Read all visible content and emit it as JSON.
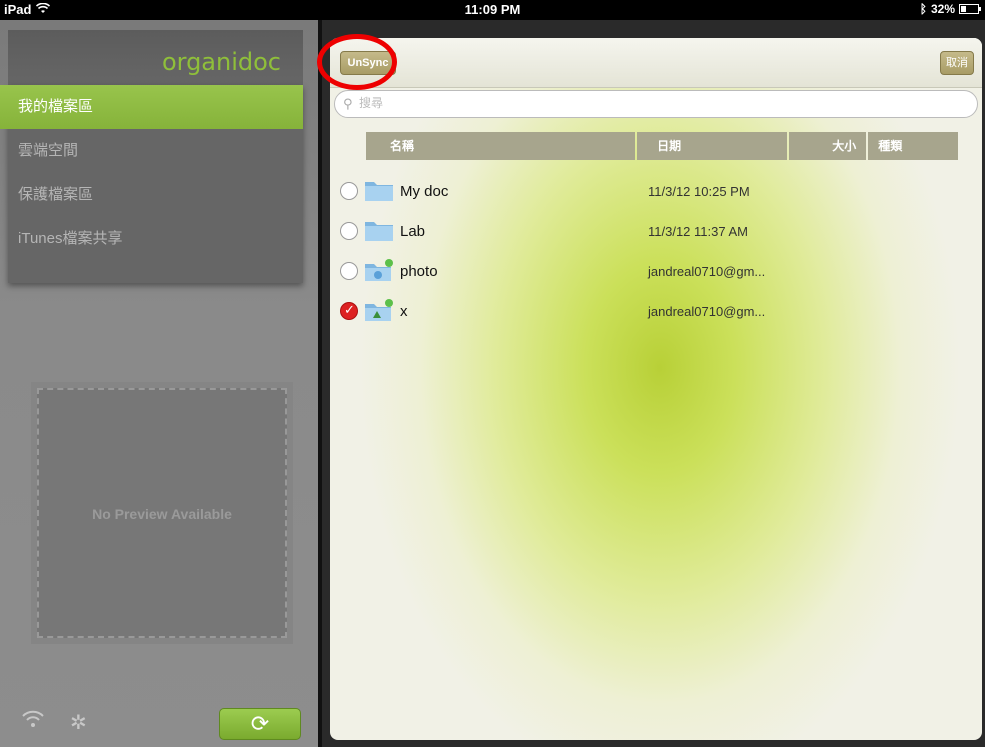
{
  "status": {
    "device": "iPad",
    "time": "11:09 PM",
    "battery": "32%",
    "battery_level": 0.32
  },
  "app": {
    "logo": "organidoc"
  },
  "sidebar": {
    "items": [
      {
        "label": "我的檔案區",
        "active": true
      },
      {
        "label": "雲端空間",
        "active": false
      },
      {
        "label": "保護檔案區",
        "active": false
      },
      {
        "label": "iTunes檔案共享",
        "active": false
      }
    ]
  },
  "preview": {
    "text": "No Preview Available"
  },
  "toolbar": {
    "unsync_label": "UnSync",
    "cancel_label": "取消"
  },
  "search": {
    "placeholder": "搜尋",
    "value": ""
  },
  "table": {
    "headers": {
      "name": "名稱",
      "date": "日期",
      "size": "大小",
      "type": "種類"
    },
    "rows": [
      {
        "name": "My doc",
        "date": "11/3/12 10:25 PM",
        "icon": "folder-icon",
        "checked": false
      },
      {
        "name": "Lab",
        "date": "11/3/12 11:37 AM",
        "icon": "folder-icon",
        "checked": false
      },
      {
        "name": "photo",
        "date": "jandreal0710@gm...",
        "icon": "cloud-folder-icon",
        "checked": false
      },
      {
        "name": "x",
        "date": "jandreal0710@gm...",
        "icon": "cloud-folder-icon",
        "checked": true
      }
    ]
  },
  "colors": {
    "accent": "#8fbf3a",
    "highlight": "#e00000"
  }
}
